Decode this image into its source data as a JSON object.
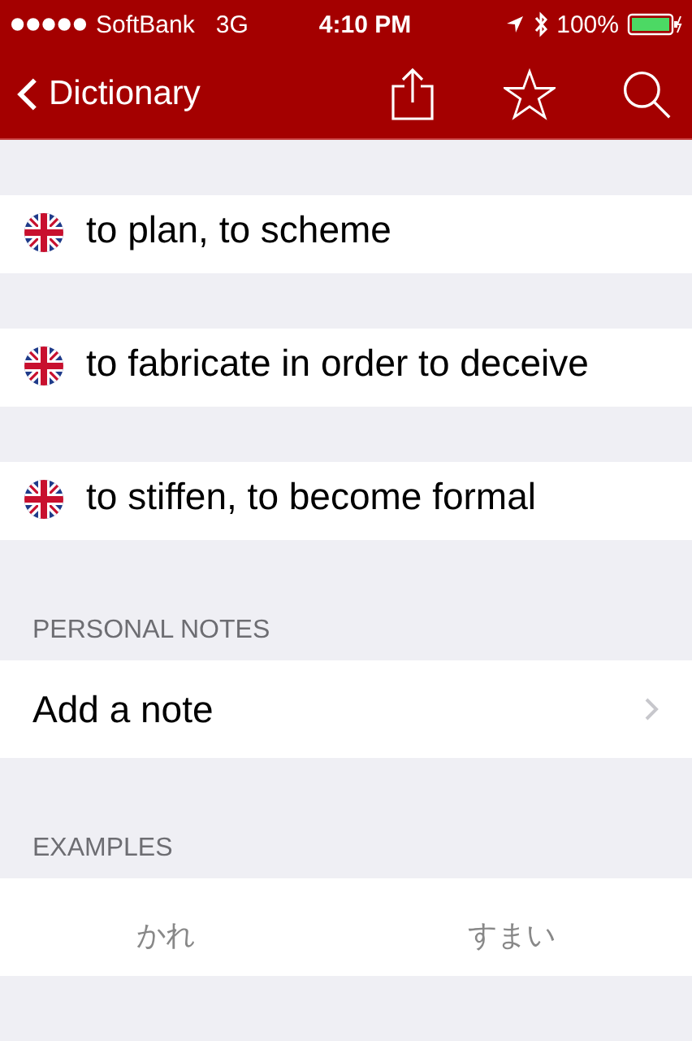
{
  "status_bar": {
    "carrier": "SoftBank",
    "network": "3G",
    "time": "4:10 PM",
    "battery": "100%"
  },
  "nav": {
    "back": "Dictionary"
  },
  "meanings": [
    {
      "text": "to plan, to scheme"
    },
    {
      "text": "to fabricate in order to deceive"
    },
    {
      "text": "to stiffen, to become formal"
    }
  ],
  "notes": {
    "header": "PERSONAL NOTES",
    "action": "Add a note"
  },
  "examples": {
    "header": "EXAMPLES",
    "items": [
      "かれ",
      "すまい"
    ]
  }
}
